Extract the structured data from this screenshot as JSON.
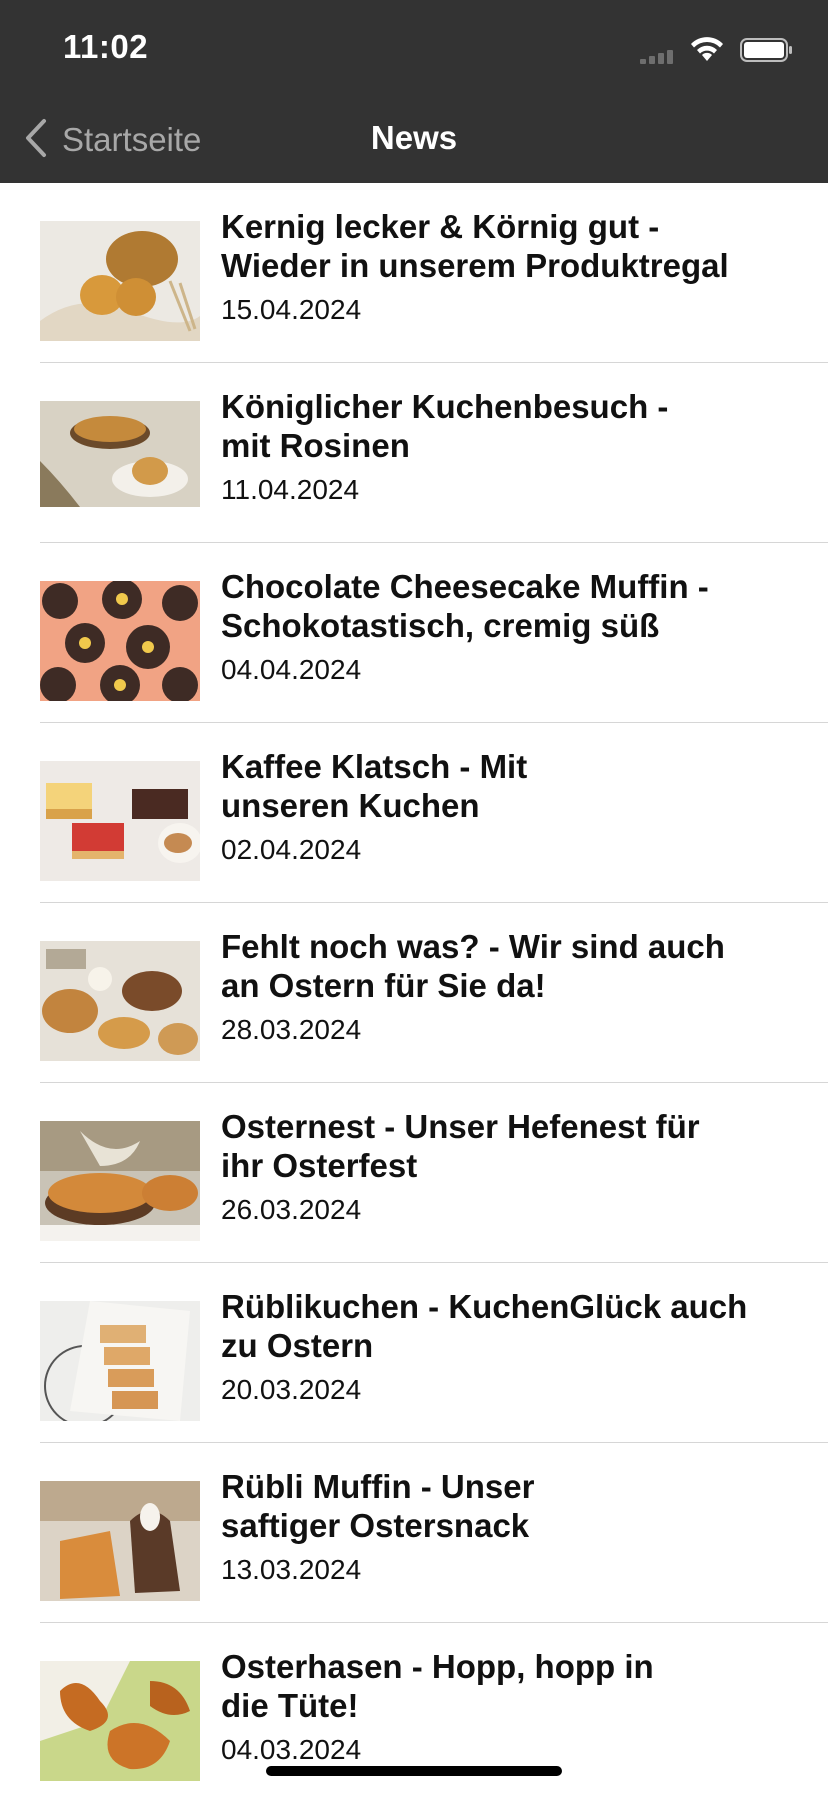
{
  "status_bar": {
    "time": "11:02"
  },
  "nav": {
    "back_label": "Startseite",
    "title": "News"
  },
  "articles": [
    {
      "title_line1": "Kernig lecker & Körnig gut -",
      "title_line2": "Wieder in unserem Produktregal",
      "date": "15.04.2024"
    },
    {
      "title_line1": "Königlicher Kuchenbesuch -",
      "title_line2": "mit Rosinen",
      "date": "11.04.2024"
    },
    {
      "title_line1": "Chocolate Cheesecake Muffin -",
      "title_line2": "Schokotastisch, cremig süß",
      "date": "04.04.2024"
    },
    {
      "title_line1": "Kaffee Klatsch - Mit",
      "title_line2": "unseren Kuchen",
      "date": "02.04.2024"
    },
    {
      "title_line1": "Fehlt noch was? - Wir sind auch",
      "title_line2": "an Ostern für Sie da!",
      "date": "28.03.2024"
    },
    {
      "title_line1": "Osternest - Unser Hefenest für",
      "title_line2": "ihr Osterfest",
      "date": "26.03.2024"
    },
    {
      "title_line1": "Rüblikuchen - KuchenGlück auch",
      "title_line2": "zu Ostern",
      "date": "20.03.2024"
    },
    {
      "title_line1": "Rübli Muffin - Unser",
      "title_line2": "saftiger Ostersnack",
      "date": "13.03.2024"
    },
    {
      "title_line1": "Osterhasen - Hopp, hopp in",
      "title_line2": "die Tüte!",
      "date": "04.03.2024"
    }
  ],
  "colors": {
    "header_bg": "#333333",
    "back_text": "#a8a8a8",
    "separator": "#d6d6d6"
  }
}
